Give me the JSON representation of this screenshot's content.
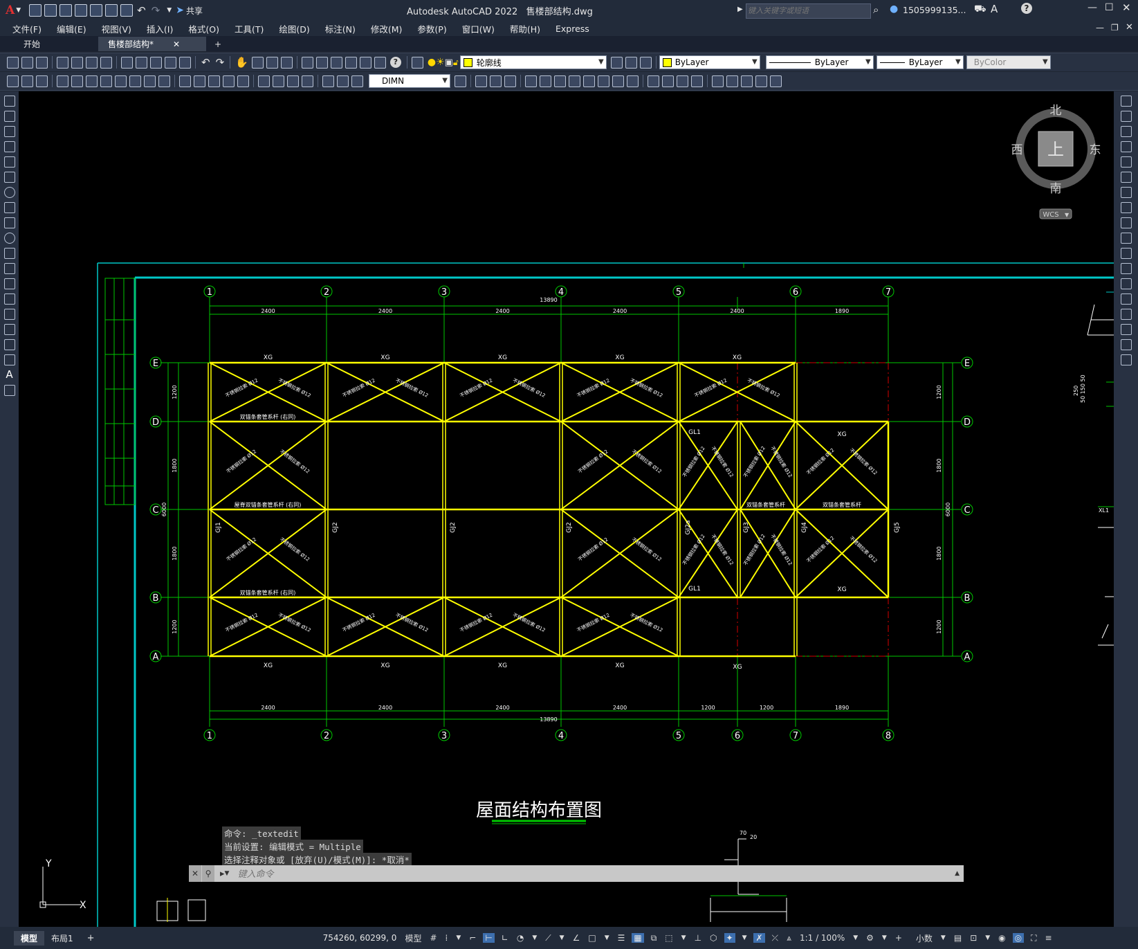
{
  "app": {
    "title": "Autodesk AutoCAD 2022",
    "filename": "售楼部结构.dwg",
    "share_label": "共享",
    "search_placeholder": "键入关键字或短语",
    "user": "1505999135...",
    "colors": {
      "canvas": "#000000",
      "frame": "#00c8c8",
      "grid": "#00c800",
      "member": "#ffff00",
      "dashed": "#d40000"
    }
  },
  "menu": [
    "文件(F)",
    "编辑(E)",
    "视图(V)",
    "插入(I)",
    "格式(O)",
    "工具(T)",
    "绘图(D)",
    "标注(N)",
    "修改(M)",
    "参数(P)",
    "窗口(W)",
    "帮助(H)",
    "Express"
  ],
  "tabs": [
    {
      "label": "开始"
    },
    {
      "label": "售楼部结构*"
    }
  ],
  "toolbar": {
    "layer": "轮廓线",
    "color": "ByLayer",
    "linetype": "ByLayer",
    "lineweight": "ByLayer",
    "plotstyle": "ByColor",
    "dimstyle": "DIMN"
  },
  "viewcube": {
    "north": "北",
    "south": "南",
    "east": "东",
    "west": "西",
    "face": "上",
    "wcs": "WCS"
  },
  "drawing": {
    "title": "屋面结构布置图",
    "top_axes": [
      "1",
      "2",
      "3",
      "4",
      "5",
      "6",
      "7"
    ],
    "bottom_axes": [
      "1",
      "2",
      "3",
      "4",
      "5",
      "6",
      "7",
      "8"
    ],
    "row_axes": [
      "E",
      "D",
      "C",
      "B",
      "A"
    ],
    "top_dims": [
      "2400",
      "2400",
      "2400",
      "2400",
      "2400",
      "1890"
    ],
    "top_total": "13890",
    "bottom_dims": [
      "2400",
      "2400",
      "2400",
      "2400",
      "1200",
      "1200",
      "1890"
    ],
    "bottom_total": "13890",
    "left_dims": [
      "1200",
      "1800",
      "1800",
      "1200"
    ],
    "left_total": "6000",
    "right_dims": [
      "1200",
      "1800",
      "1800",
      "1200"
    ],
    "right_total": "6000",
    "member_xg": "XG",
    "brace_label": "不锈钢拉索",
    "brace_size": "Ø12",
    "tube_label_1": "双锚条套管系杆",
    "tube_label_2": "屋脊双锚条套管系杆",
    "same_note": "(右同)",
    "frames": [
      "GJ1",
      "GJ2",
      "GJ2",
      "GJ2",
      "GJ2a",
      "GJ3",
      "GJ4",
      "GJ5"
    ],
    "gl1": "GL1",
    "detail_dims": [
      "70",
      "20",
      "250",
      "50 150 50"
    ],
    "xl_label": "XL1"
  },
  "command": {
    "lines": [
      "命令: _textedit",
      "当前设置: 编辑模式 = Multiple",
      "选择注释对象或 [放弃(U)/模式(M)]: *取消*"
    ],
    "placeholder": "键入命令"
  },
  "ucs": {
    "x": "X",
    "y": "Y"
  },
  "layout_tabs": [
    "模型",
    "布局1"
  ],
  "status": {
    "coords": "754260, 60299, 0",
    "model": "模型",
    "scale": "1:1 / 100%",
    "units": "小数"
  }
}
